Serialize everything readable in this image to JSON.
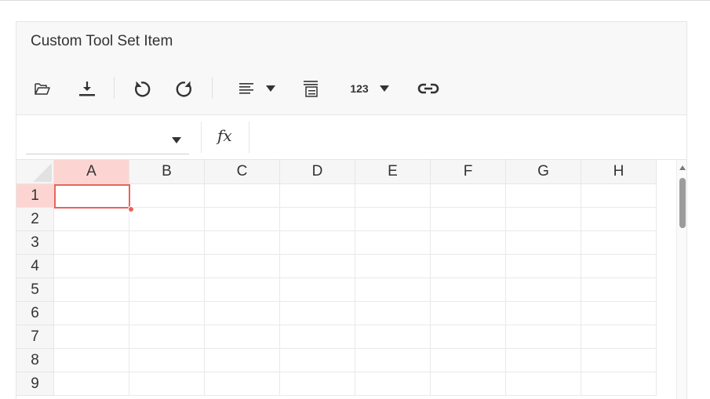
{
  "panel": {
    "title": "Custom Tool Set Item"
  },
  "toolbar": {
    "items": [
      {
        "name": "open-icon"
      },
      {
        "name": "download-icon"
      },
      {
        "name": "undo-icon"
      },
      {
        "name": "redo-icon"
      },
      {
        "name": "align-left-icon"
      },
      {
        "name": "wrap-text-icon"
      },
      {
        "name": "number-format-icon"
      },
      {
        "name": "link-icon"
      }
    ],
    "number_format_label": "123"
  },
  "formula_bar": {
    "name_box_value": "",
    "fx_label": "fx",
    "formula_value": ""
  },
  "grid": {
    "columns": [
      "A",
      "B",
      "C",
      "D",
      "E",
      "F",
      "G",
      "H"
    ],
    "rows": [
      "1",
      "2",
      "3",
      "4",
      "5",
      "6",
      "7",
      "8",
      "9"
    ],
    "active_cell": "A1",
    "accent_color": "#e9635a",
    "header_highlight_color": "#fcd5d2"
  }
}
